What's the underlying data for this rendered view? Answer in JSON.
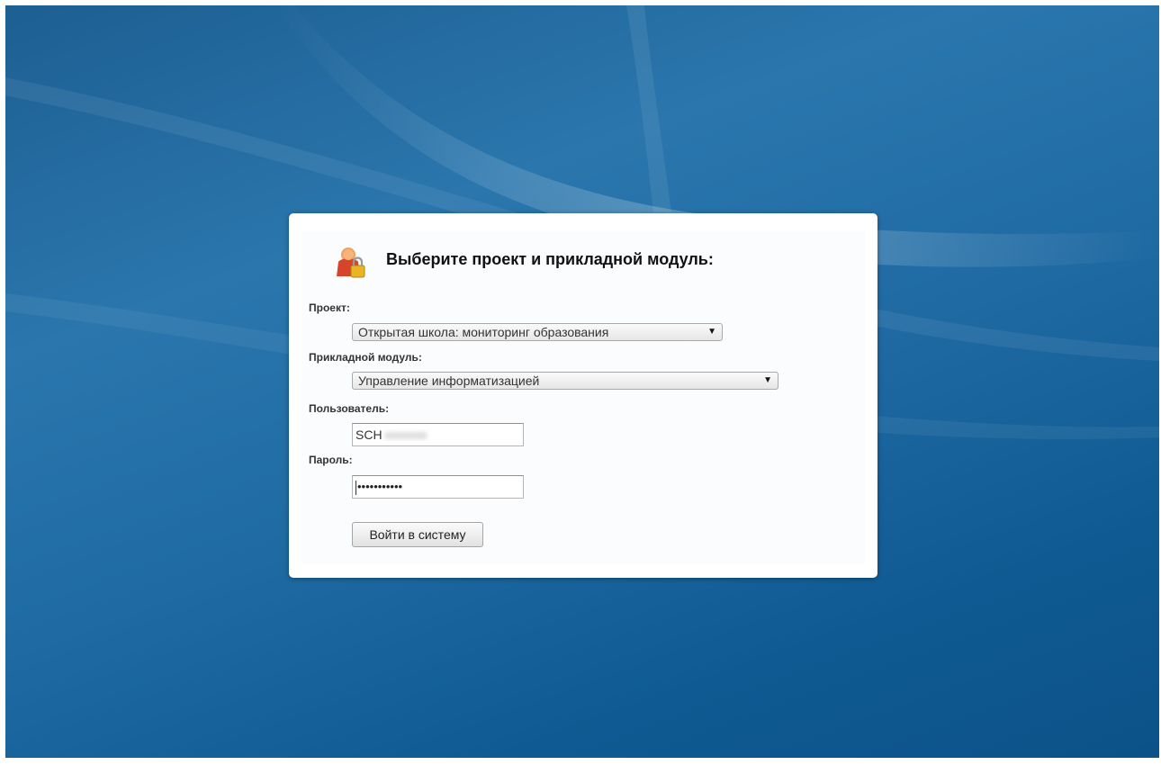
{
  "login_dialog": {
    "title": "Выберите проект и прикладной модуль:",
    "icon": "user-lock-icon",
    "project": {
      "label": "Проект:",
      "selected": "Открытая школа: мониторинг образования"
    },
    "module": {
      "label": "Прикладной модуль:",
      "selected": "Управление информатизацией"
    },
    "user": {
      "label": "Пользователь:",
      "value": "SCH"
    },
    "password": {
      "label": "Пароль:",
      "value": "•••••••••••"
    },
    "submit_label": "Войти в систему"
  },
  "colors": {
    "background": "#1f6aa3",
    "dialog": "#ffffff"
  }
}
